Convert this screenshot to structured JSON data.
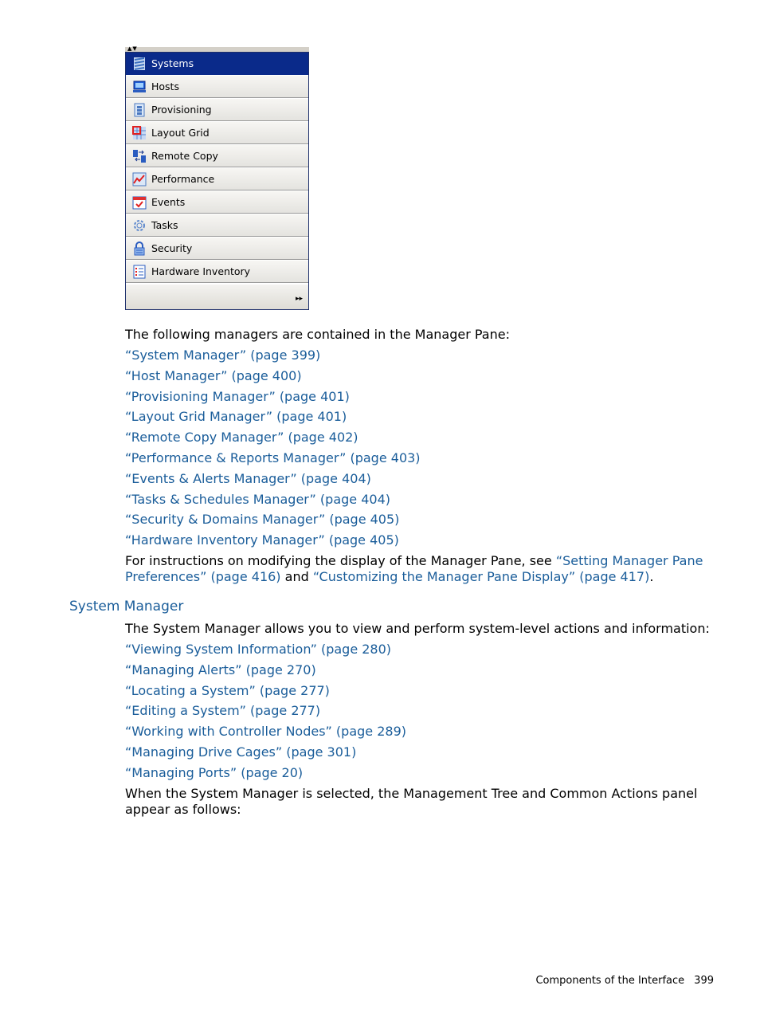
{
  "manager_pane": {
    "items": [
      {
        "label": "Systems",
        "icon": "systems-icon",
        "selected": true
      },
      {
        "label": "Hosts",
        "icon": "hosts-icon",
        "selected": false
      },
      {
        "label": "Provisioning",
        "icon": "provisioning-icon",
        "selected": false
      },
      {
        "label": "Layout Grid",
        "icon": "layout-grid-icon",
        "selected": false
      },
      {
        "label": "Remote Copy",
        "icon": "remote-copy-icon",
        "selected": false
      },
      {
        "label": "Performance",
        "icon": "performance-icon",
        "selected": false
      },
      {
        "label": "Events",
        "icon": "events-icon",
        "selected": false
      },
      {
        "label": "Tasks",
        "icon": "tasks-icon",
        "selected": false
      },
      {
        "label": "Security",
        "icon": "security-icon",
        "selected": false
      },
      {
        "label": "Hardware Inventory",
        "icon": "hardware-inventory-icon",
        "selected": false
      }
    ],
    "resize_arrows": "▲▼",
    "more_button": "▸▸"
  },
  "section1": {
    "intro": "The following managers are contained in the Manager Pane:",
    "links": [
      "“System Manager” (page 399)",
      "“Host Manager” (page 400)",
      "“Provisioning Manager” (page 401)",
      "“Layout Grid Manager” (page 401)",
      "“Remote Copy Manager” (page 402)",
      "“Performance & Reports Manager” (page 403)",
      "“Events & Alerts Manager” (page 404)",
      "“Tasks & Schedules Manager” (page 404)",
      "“Security & Domains Manager” (page 405)",
      "“Hardware Inventory Manager” (page 405)"
    ],
    "instructions_prefix": "For instructions on modifying the display of the Manager Pane, see ",
    "instructions_link1": "“Setting Manager Pane Preferences” (page 416)",
    "instructions_middle": " and ",
    "instructions_link2": "“Customizing the Manager Pane Display” (page 417)",
    "instructions_suffix": "."
  },
  "section2": {
    "heading": "System Manager",
    "intro": "The System Manager allows you to view and perform system-level actions and information:",
    "links": [
      "“Viewing System Information” (page 280)",
      "“Managing Alerts” (page 270)",
      "“Locating a System” (page 277)",
      "“Editing a System” (page 277)",
      "“Working with Controller Nodes” (page 289)",
      "“Managing Drive Cages” (page 301)",
      "“Managing Ports” (page 20)"
    ],
    "closing": "When the System Manager is selected, the Management Tree and Common Actions panel appear as follows:"
  },
  "footer": {
    "section_title": "Components of the Interface",
    "page_number": "399"
  },
  "colors": {
    "link": "#1a5d9a",
    "selected_item": "#0a2a8a",
    "pane_border": "#1d2f6b"
  }
}
